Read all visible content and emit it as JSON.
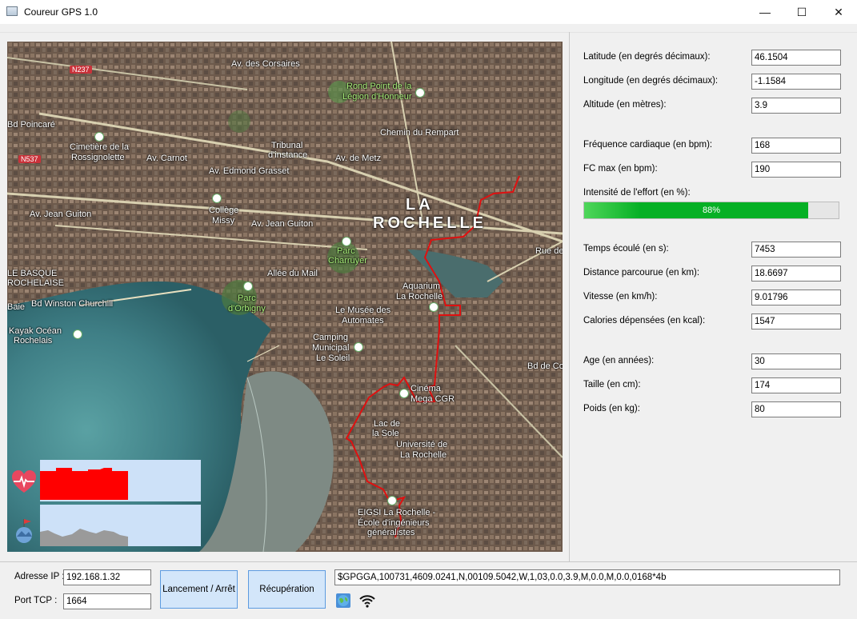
{
  "window": {
    "title": "Coureur GPS 1.0",
    "minimize": "—",
    "maximize": "☐",
    "close": "✕"
  },
  "map": {
    "labels": [
      "Av. des Corsaires",
      "Rond Point de la",
      "Légion d'Honneur",
      "N237",
      "N537",
      "Cimetière de la",
      "Rossignolette",
      "Av. Carnot",
      "Tribunal",
      "d'instance",
      "Av. Edmond Grasset",
      "Av. de Metz",
      "Chemin du Rempart",
      "Av. Jean Guiton",
      "Collège",
      "Missy",
      "Av. Jean Guiton",
      "LA",
      "ROCHELLE",
      "Parc",
      "Charruyer",
      "Allée du Mail",
      "Parc",
      "d'Orbigny",
      "Bd Winston Churchill",
      "Kayak Océan",
      "Rochelais",
      "Aquarium",
      "La Rochelle",
      "Le Musée des",
      "Automates",
      "Camping",
      "Municipal",
      "Le Soleil",
      "Cinéma",
      "Mega CGR",
      "Lac de",
      "la Sole",
      "Université de",
      "La Rochelle",
      "EIGSI La Rochelle -",
      "École d'ingénieurs",
      "généralistes",
      "LE BASQUE",
      "ROCHELAISE",
      "Baie",
      "Bd Poincaré",
      "Rue de",
      "Bd de Cognehors"
    ]
  },
  "graphs": {
    "heart_icon": "heart-pulse-icon",
    "terrain_icon": "terrain-flag-icon"
  },
  "fields": {
    "latitude": {
      "label": "Latitude (en degrés décimaux):",
      "value": "46.1504"
    },
    "longitude": {
      "label": "Longitude (en degrés décimaux):",
      "value": "-1.1584"
    },
    "altitude": {
      "label": "Altitude (en mètres):",
      "value": "3.9"
    },
    "fc": {
      "label": "Fréquence cardiaque (en bpm):",
      "value": "168"
    },
    "fcmax": {
      "label": "FC max (en bpm):",
      "value": "190"
    },
    "intensite": {
      "label": "Intensité de l'effort (en %):",
      "value": "88%",
      "percent": 88
    },
    "temps": {
      "label": "Temps écoulé (en s):",
      "value": "7453"
    },
    "distance": {
      "label": "Distance parcourue (en km):",
      "value": "18.6697"
    },
    "vitesse": {
      "label": "Vitesse (en km/h):",
      "value": "9.01796"
    },
    "calories": {
      "label": "Calories dépensées (en kcal):",
      "value": "1547"
    },
    "age": {
      "label": "Age (en années):",
      "value": "30"
    },
    "taille": {
      "label": "Taille (en cm):",
      "value": "174"
    },
    "poids": {
      "label": "Poids (en kg):",
      "value": "80"
    }
  },
  "bottom": {
    "ip_label": "Adresse IP :",
    "ip_value": "192.168.1.32",
    "port_label": "Port TCP :",
    "port_value": "1664",
    "start_button": "Lancement / Arrêt",
    "fetch_button": "Récupération",
    "nmea": "$GPGGA,100731,4609.0241,N,00109.5042,W,1,03,0.0,3.9,M,0.0,M,0.0,0168*4b",
    "globe_icon": "globe-icon",
    "wifi_icon": "wifi-icon"
  },
  "colors": {
    "accent": "#06b025",
    "route": "#e01010",
    "graph_bg": "#cde1f8",
    "heart_bar": "#ff0000"
  }
}
